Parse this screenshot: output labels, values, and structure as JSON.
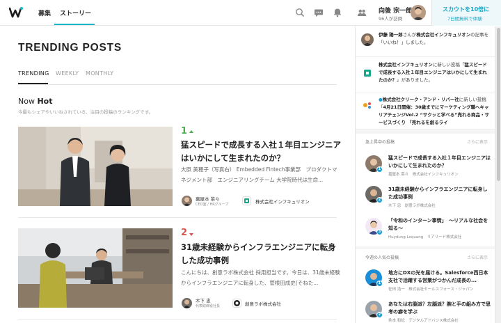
{
  "header": {
    "nav": [
      {
        "label": "募集"
      },
      {
        "label": "ストーリー"
      }
    ],
    "user_name": "向後 宗一郎",
    "user_sub": "96人が訪問",
    "cta_line1": "スカウトを10倍に",
    "cta_line2": "7日間無料で体験",
    "icons": [
      "search-icon",
      "chat-icon",
      "bell-icon",
      "people-icon"
    ]
  },
  "main": {
    "title": "TRENDING POSTS",
    "tabs": [
      {
        "label": "TRENDING"
      },
      {
        "label": "WEEKLY"
      },
      {
        "label": "MONTHLY"
      }
    ],
    "section_title_prefix": "Now",
    "section_title_bold": "Hot",
    "section_sub": "今最もシェアやいいねされている、注目の投稿のランキングです。",
    "posts": [
      {
        "rank": "1",
        "trend": "up",
        "title": "猛スピードで成長する入社１年目エンジニアはいかにして生まれたのか？",
        "excerpt": "大原 美穂子（写真右） Embedded Fintech事業部　プロダクトマネジメント部　エンジニアリングチーム 大学院時代は生命...",
        "author": "嘉屋本 菜々",
        "author_role": "CEO室 / HRグループ",
        "company": "株式会社インフキュリオン"
      },
      {
        "rank": "2",
        "trend": "down",
        "title": "31歳未経験からインフラエンジニアに転身した成功事例",
        "excerpt": "こんにちは、創意ラボ株式会社 採用担当です。今日は、31歳未経験からインフラエンジニアに転身した、菅根田成史(そねた...",
        "author": "木下 忠",
        "author_role": "代表取締役社長",
        "company": "創意ラボ株式会社"
      }
    ]
  },
  "sidebar": {
    "notifications": [
      {
        "text_bold": "伊藤 陽一郎",
        "text": "さんが",
        "text_bold2": "株式会社インフキュリオン",
        "text_end": "の記事を「いいね！」しました。"
      },
      {
        "text_bold": "株式会社インフキュリオン",
        "text": "に新しい投稿「",
        "text_bold2": "猛スピードで成長する入社１年目エンジニアはいかにして生まれたのか？",
        "text_end": "」がありました。"
      },
      {
        "text_bold": "株式会社クリーク・アンド・リバー社",
        "text": "に新しい投稿「",
        "text_bold2": "4月21日開催：30歳までにマーケティング職へキャリアチェンジVol.2 “サクッと学べる”売れる商品・サービスづくり 「売れるを創るライ",
        "text_end": ""
      }
    ],
    "rising_head": "急上昇中の投稿",
    "more_label": "さらに表示",
    "rising": [
      {
        "title": "猛スピードで成長する入社１年目エンジニアはいかにして生まれたのか？",
        "meta": "嘉屋本 菜々　株式会社インフキュリオン"
      },
      {
        "title": "31歳未経験からインフラエンジニアに転身した成功事例",
        "meta": "木下 忠　創意ラボ株式会社"
      },
      {
        "title": "「令和のインターン事情」　〜リアルな社会を知る〜",
        "meta": "Huydung Lequang　リアリード株式会社"
      }
    ],
    "popular_head": "今週の人気の投稿",
    "popular": [
      {
        "title": "地方にDXの光を届ける。Salesforce西日本支社で活躍する営業がつかんだ成長の...",
        "meta": "佐田 浩一　株式会社セールスフォース・ジャパン"
      },
      {
        "title": "あなたは右脳派？左脳派？腕と手の組み方で思考の癖を学ぶ",
        "meta": "条本 和紀　デジタルアドバンス株式会社"
      }
    ]
  },
  "colors": {
    "accent": "#18b6c8",
    "rank_up": "#4caf50",
    "rank_down": "#d9534f"
  }
}
